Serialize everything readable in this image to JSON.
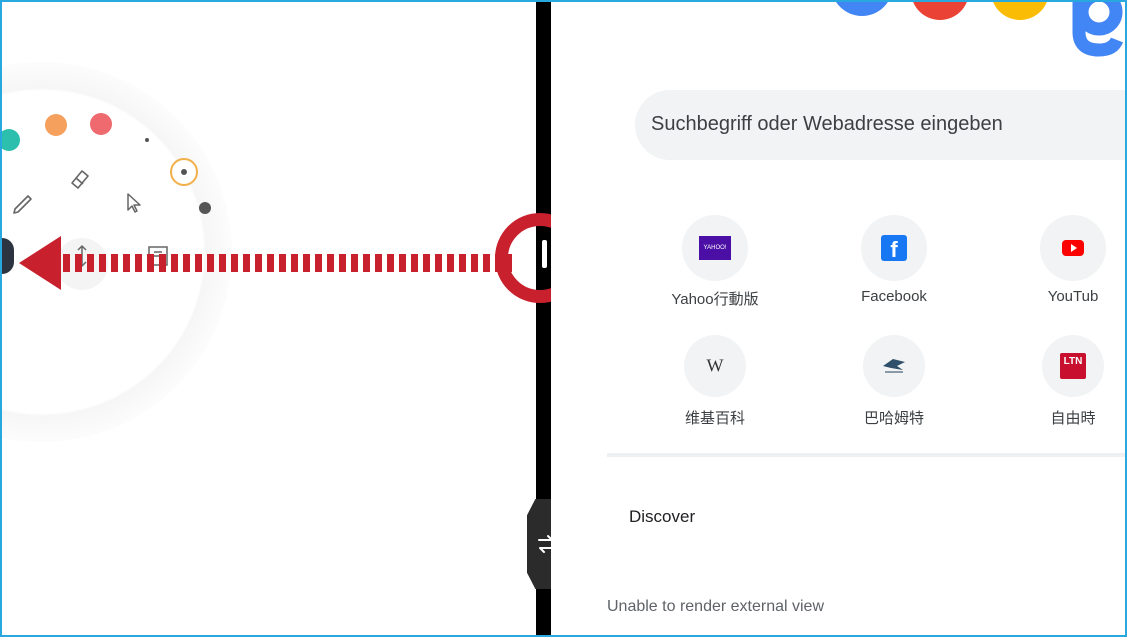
{
  "browser": {
    "search_placeholder": "Suchbegriff oder Webadresse eingeben",
    "shortcuts": [
      {
        "label": "Yahoo行動版",
        "icon": "yahoo-icon",
        "icon_text": "YAHOO!"
      },
      {
        "label": "Facebook",
        "icon": "facebook-icon",
        "icon_text": "f"
      },
      {
        "label": "YouTub",
        "icon": "youtube-icon",
        "icon_text": ""
      },
      {
        "label": "维基百科",
        "icon": "wikipedia-icon",
        "icon_text": "W"
      },
      {
        "label": "巴哈姆特",
        "icon": "bahamut-icon",
        "icon_text": ""
      },
      {
        "label": "自由時",
        "icon": "ltn-icon",
        "icon_text": "LTN"
      }
    ],
    "discover_label": "Discover",
    "external_view_message": "Unable to render external view"
  },
  "pen_wheel": {
    "colors": [
      "#2dbfae",
      "#f5a05c",
      "#ee6a6e"
    ],
    "icons": [
      "pen-icon",
      "eraser-icon",
      "pointer-icon",
      "move-icon",
      "stamp-icon",
      "size-large-dot-icon",
      "size-small-dot-icon"
    ]
  },
  "splitter": {
    "icon": "swap-arrows-icon"
  },
  "colors": {
    "frame_border": "#29a8e0",
    "annotation": "#c8202c",
    "divider": "#000000",
    "google_blue": "#4285f4",
    "google_red": "#ea4335",
    "google_yellow": "#fbbc05"
  }
}
